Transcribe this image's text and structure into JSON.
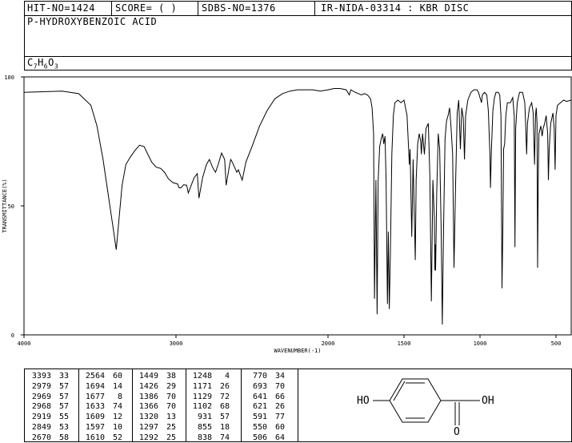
{
  "header": {
    "hit_no": "HIT-NO=1424",
    "score": "SCORE=  (   )",
    "sdbs_no": "SDBS-NO=1376",
    "method": "IR-NIDA-03314 : KBR DISC"
  },
  "compound": {
    "name": "P-HYDROXYBENZOIC ACID",
    "formula_c": "C",
    "formula_c_sub": "7",
    "formula_h": "H",
    "formula_h_sub": "6",
    "formula_o": "O",
    "formula_o_sub": "3"
  },
  "chart_data": {
    "type": "line",
    "xlabel": "WAVENUMBER(-1)",
    "ylabel": "TRANSMITTANCE(%)",
    "xlim": [
      4000,
      400
    ],
    "ylim": [
      0,
      100
    ],
    "x_ticks": [
      4000,
      3000,
      2000,
      1500,
      1000,
      500
    ],
    "y_ticks": [
      100,
      50,
      0
    ],
    "x_tick_labels": [
      "4000",
      "3000",
      "2000",
      "1500",
      "1000",
      "500"
    ],
    "y_tick_labels": [
      "100",
      "50",
      "0"
    ],
    "series": [
      {
        "points": [
          [
            4000,
            94
          ],
          [
            3750,
            94.5
          ],
          [
            3640,
            93.5
          ],
          [
            3560,
            89
          ],
          [
            3520,
            81
          ],
          [
            3480,
            68
          ],
          [
            3440,
            52
          ],
          [
            3410,
            40
          ],
          [
            3393,
            33
          ],
          [
            3375,
            45
          ],
          [
            3355,
            58
          ],
          [
            3330,
            66
          ],
          [
            3300,
            69
          ],
          [
            3270,
            71.5
          ],
          [
            3240,
            73.5
          ],
          [
            3210,
            73
          ],
          [
            3185,
            70
          ],
          [
            3160,
            67
          ],
          [
            3130,
            65
          ],
          [
            3100,
            64.5
          ],
          [
            3075,
            63
          ],
          [
            3050,
            60.5
          ],
          [
            3020,
            59
          ],
          [
            2990,
            58.5
          ],
          [
            2979,
            57
          ],
          [
            2968,
            57
          ],
          [
            2950,
            58.2
          ],
          [
            2930,
            58
          ],
          [
            2919,
            55
          ],
          [
            2900,
            58
          ],
          [
            2880,
            61
          ],
          [
            2860,
            62.5
          ],
          [
            2849,
            53
          ],
          [
            2825,
            61
          ],
          [
            2800,
            66
          ],
          [
            2780,
            68
          ],
          [
            2760,
            65
          ],
          [
            2740,
            63
          ],
          [
            2720,
            66.5
          ],
          [
            2700,
            70.5
          ],
          [
            2680,
            68
          ],
          [
            2670,
            58
          ],
          [
            2650,
            65
          ],
          [
            2640,
            68
          ],
          [
            2630,
            67
          ],
          [
            2600,
            63
          ],
          [
            2590,
            64
          ],
          [
            2564,
            60
          ],
          [
            2540,
            67
          ],
          [
            2500,
            73
          ],
          [
            2450,
            81
          ],
          [
            2400,
            87
          ],
          [
            2350,
            91.5
          ],
          [
            2300,
            93.5
          ],
          [
            2250,
            94.5
          ],
          [
            2200,
            95
          ],
          [
            2150,
            95
          ],
          [
            2100,
            95
          ],
          [
            2050,
            94.5
          ],
          [
            2000,
            95
          ],
          [
            1960,
            95.5
          ],
          [
            1920,
            95.5
          ],
          [
            1880,
            95
          ],
          [
            1860,
            93
          ],
          [
            1850,
            95
          ],
          [
            1820,
            94
          ],
          [
            1780,
            93
          ],
          [
            1760,
            93.5
          ],
          [
            1740,
            93
          ],
          [
            1720,
            91.5
          ],
          [
            1710,
            88
          ],
          [
            1700,
            78
          ],
          [
            1694,
            14
          ],
          [
            1685,
            60
          ],
          [
            1677,
            8
          ],
          [
            1670,
            60
          ],
          [
            1660,
            73
          ],
          [
            1650,
            76
          ],
          [
            1640,
            78
          ],
          [
            1633,
            74
          ],
          [
            1625,
            77
          ],
          [
            1618,
            60
          ],
          [
            1609,
            12
          ],
          [
            1603,
            40
          ],
          [
            1597,
            10
          ],
          [
            1590,
            30
          ],
          [
            1580,
            70
          ],
          [
            1570,
            85
          ],
          [
            1560,
            90
          ],
          [
            1540,
            91
          ],
          [
            1520,
            90
          ],
          [
            1500,
            91
          ],
          [
            1480,
            85
          ],
          [
            1465,
            66
          ],
          [
            1460,
            72
          ],
          [
            1449,
            38
          ],
          [
            1440,
            68
          ],
          [
            1426,
            29
          ],
          [
            1420,
            60
          ],
          [
            1410,
            74
          ],
          [
            1400,
            78
          ],
          [
            1390,
            75
          ],
          [
            1386,
            70
          ],
          [
            1378,
            78
          ],
          [
            1366,
            70
          ],
          [
            1355,
            80
          ],
          [
            1340,
            82
          ],
          [
            1330,
            62
          ],
          [
            1320,
            13
          ],
          [
            1310,
            60
          ],
          [
            1300,
            45
          ],
          [
            1297,
            25
          ],
          [
            1294,
            35
          ],
          [
            1292,
            25
          ],
          [
            1285,
            55
          ],
          [
            1275,
            78
          ],
          [
            1265,
            72
          ],
          [
            1255,
            40
          ],
          [
            1248,
            4
          ],
          [
            1240,
            40
          ],
          [
            1230,
            76
          ],
          [
            1220,
            83
          ],
          [
            1210,
            85
          ],
          [
            1200,
            88
          ],
          [
            1190,
            80
          ],
          [
            1180,
            70
          ],
          [
            1171,
            26
          ],
          [
            1160,
            60
          ],
          [
            1150,
            86
          ],
          [
            1140,
            91
          ],
          [
            1129,
            72
          ],
          [
            1120,
            88
          ],
          [
            1110,
            84
          ],
          [
            1102,
            68
          ],
          [
            1095,
            85
          ],
          [
            1080,
            91
          ],
          [
            1060,
            94
          ],
          [
            1040,
            95
          ],
          [
            1020,
            95
          ],
          [
            1010,
            94
          ],
          [
            1000,
            92
          ],
          [
            990,
            90
          ],
          [
            985,
            93
          ],
          [
            970,
            94
          ],
          [
            955,
            93
          ],
          [
            945,
            87
          ],
          [
            935,
            70
          ],
          [
            931,
            57
          ],
          [
            925,
            72
          ],
          [
            915,
            87
          ],
          [
            905,
            92
          ],
          [
            895,
            94
          ],
          [
            880,
            94
          ],
          [
            870,
            93
          ],
          [
            862,
            85
          ],
          [
            855,
            18
          ],
          [
            850,
            40
          ],
          [
            845,
            72
          ],
          [
            838,
            74
          ],
          [
            830,
            85
          ],
          [
            820,
            90
          ],
          [
            800,
            90
          ],
          [
            785,
            92
          ],
          [
            775,
            85
          ],
          [
            770,
            34
          ],
          [
            765,
            80
          ],
          [
            755,
            90
          ],
          [
            740,
            94
          ],
          [
            720,
            94
          ],
          [
            705,
            90
          ],
          [
            700,
            82
          ],
          [
            693,
            70
          ],
          [
            688,
            82
          ],
          [
            675,
            88
          ],
          [
            660,
            90
          ],
          [
            650,
            86
          ],
          [
            641,
            66
          ],
          [
            635,
            85
          ],
          [
            630,
            88
          ],
          [
            625,
            82
          ],
          [
            621,
            26
          ],
          [
            617,
            60
          ],
          [
            612,
            78
          ],
          [
            600,
            81
          ],
          [
            591,
            77
          ],
          [
            585,
            80
          ],
          [
            575,
            82
          ],
          [
            565,
            85
          ],
          [
            555,
            78
          ],
          [
            550,
            60
          ],
          [
            545,
            72
          ],
          [
            535,
            82
          ],
          [
            520,
            86
          ],
          [
            512,
            80
          ],
          [
            506,
            64
          ],
          [
            500,
            85
          ],
          [
            490,
            89
          ],
          [
            470,
            90
          ],
          [
            450,
            91
          ],
          [
            430,
            90.5
          ],
          [
            400,
            91
          ]
        ]
      }
    ],
    "peak_table": [
      {
        "wn": "3393",
        "t": "33"
      },
      {
        "wn": "2979",
        "t": "57"
      },
      {
        "wn": "2969",
        "t": "57"
      },
      {
        "wn": "2968",
        "t": "57"
      },
      {
        "wn": "2919",
        "t": "55"
      },
      {
        "wn": "2849",
        "t": "53"
      },
      {
        "wn": "2670",
        "t": "58"
      },
      {
        "wn": "2564",
        "t": "60"
      },
      {
        "wn": "1694",
        "t": "14"
      },
      {
        "wn": "1677",
        "t": "8"
      },
      {
        "wn": "1633",
        "t": "74"
      },
      {
        "wn": "1609",
        "t": "12"
      },
      {
        "wn": "1597",
        "t": "10"
      },
      {
        "wn": "1610",
        "t": "52"
      },
      {
        "wn": "1449",
        "t": "38"
      },
      {
        "wn": "1426",
        "t": "29"
      },
      {
        "wn": "1386",
        "t": "70"
      },
      {
        "wn": "1366",
        "t": "70"
      },
      {
        "wn": "1320",
        "t": "13"
      },
      {
        "wn": "1297",
        "t": "25"
      },
      {
        "wn": "1292",
        "t": "25"
      },
      {
        "wn": "1248",
        "t": "4"
      },
      {
        "wn": "1171",
        "t": "26"
      },
      {
        "wn": "1129",
        "t": "72"
      },
      {
        "wn": "1102",
        "t": "68"
      },
      {
        "wn": "931",
        "t": "57"
      },
      {
        "wn": "855",
        "t": "18"
      },
      {
        "wn": "838",
        "t": "74"
      },
      {
        "wn": "770",
        "t": "34"
      },
      {
        "wn": "693",
        "t": "70"
      },
      {
        "wn": "641",
        "t": "66"
      },
      {
        "wn": "621",
        "t": "26"
      },
      {
        "wn": "591",
        "t": "77"
      },
      {
        "wn": "550",
        "t": "60"
      },
      {
        "wn": "506",
        "t": "64"
      }
    ]
  },
  "structure": {
    "left_group": "HO",
    "right_group": "OH",
    "carbonyl_o": "O"
  }
}
